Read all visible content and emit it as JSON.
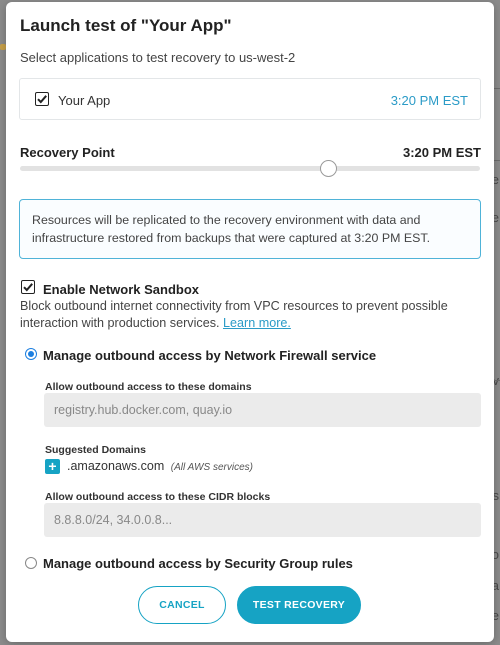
{
  "modal": {
    "title": "Launch test of \"Your App\"",
    "subtitle": "Select applications to test recovery to us-west-2"
  },
  "app": {
    "checked": true,
    "name": "Your App",
    "time": "3:20 PM EST"
  },
  "recovery_point": {
    "label": "Recovery Point",
    "time": "3:20 PM EST",
    "slider_value_fraction": 0.67
  },
  "info": {
    "text": "Resources will be replicated to the recovery environment with data and infrastructure restored from backups that were captured at 3:20 PM EST."
  },
  "sandbox": {
    "checked": true,
    "label": "Enable Network Sandbox",
    "description": "Block outbound internet connectivity from VPC resources to prevent possible interaction with production services.",
    "learn_more": "Learn more."
  },
  "option_firewall": {
    "selected": true,
    "label": "Manage outbound access by Network Firewall service",
    "domains_label": "Allow outbound access to these domains",
    "domains_placeholder": "registry.hub.docker.com, quay.io",
    "suggested_label": "Suggested Domains",
    "suggested_domain": ".amazonaws.com",
    "suggested_note": "(All AWS services)",
    "cidr_label": "Allow outbound access to these CIDR blocks",
    "cidr_placeholder": "8.8.8.0/24, 34.0.0.8..."
  },
  "option_security_group": {
    "selected": false,
    "label": "Manage outbound access by Security Group rules"
  },
  "buttons": {
    "cancel": "CANCEL",
    "test": "TEST RECOVERY"
  },
  "background": {
    "fragments": [
      "e",
      "e",
      "v",
      "s",
      "ro",
      "a",
      "te"
    ]
  },
  "colors": {
    "accent": "#16a3c4",
    "link": "#2b9bc7",
    "radio_selected": "#1c7fe0",
    "info_border": "#4fb3d8"
  }
}
